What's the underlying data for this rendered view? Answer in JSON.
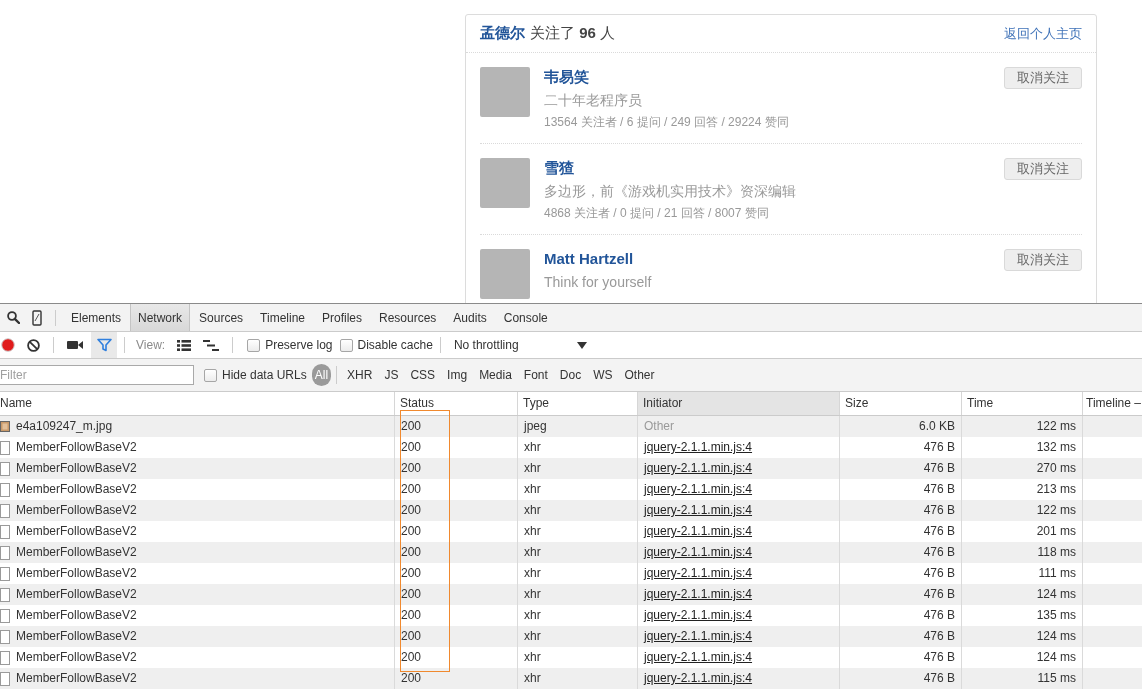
{
  "page": {
    "header": {
      "user": "孟德尔",
      "summary": "关注了 **96** 人",
      "back_link": "返回个人主页"
    },
    "followees": [
      {
        "name": "韦易笑",
        "bio": "二十年老程序员",
        "stats": "13564 关注者 / 6 提问 / 249 回答 / 29224 赞同",
        "button": "取消关注"
      },
      {
        "name": "雪猹",
        "bio": "多边形，前《游戏机实用技术》资深编辑",
        "stats": "4868 关注者 / 0 提问 / 21 回答 / 8007 赞同",
        "button": "取消关注"
      },
      {
        "name": "Matt Hartzell",
        "bio": "Think for yourself",
        "button": "取消关注"
      }
    ]
  },
  "devtools": {
    "tabs": [
      {
        "label": "Elements",
        "selected": false
      },
      {
        "label": "Network",
        "selected": true
      },
      {
        "label": "Sources",
        "selected": false
      },
      {
        "label": "Timeline",
        "selected": false
      },
      {
        "label": "Profiles",
        "selected": false
      },
      {
        "label": "Resources",
        "selected": false
      },
      {
        "label": "Audits",
        "selected": false
      },
      {
        "label": "Console",
        "selected": false
      }
    ],
    "toolbar": {
      "recording": true,
      "filter_active": true,
      "view_label": "View:",
      "checkboxes": [
        {
          "label": "Preserve log",
          "checked": false
        },
        {
          "label": "Disable cache",
          "checked": false
        }
      ],
      "throttling": "No throttling"
    },
    "filter_bar": {
      "placeholder": "Filter",
      "hide_data_urls": {
        "label": "Hide data URLs",
        "checked": false
      },
      "types": [
        {
          "label": "All",
          "selected": true
        },
        {
          "label": "XHR",
          "selected": false
        },
        {
          "label": "JS",
          "selected": false
        },
        {
          "label": "CSS",
          "selected": false
        },
        {
          "label": "Img",
          "selected": false
        },
        {
          "label": "Media",
          "selected": false
        },
        {
          "label": "Font",
          "selected": false
        },
        {
          "label": "Doc",
          "selected": false
        },
        {
          "label": "WS",
          "selected": false
        },
        {
          "label": "Other",
          "selected": false
        }
      ]
    },
    "table": {
      "columns": [
        {
          "label": "Name",
          "sorted": false
        },
        {
          "label": "Status",
          "sorted": false
        },
        {
          "label": "Type",
          "sorted": false
        },
        {
          "label": "Initiator",
          "sorted": true
        },
        {
          "label": "Size",
          "sorted": false
        },
        {
          "label": "Time",
          "sorted": false
        },
        {
          "label": "Timeline –",
          "sorted": false
        }
      ],
      "annotation": {
        "kind": "rectangle"
      },
      "rows": [
        {
          "kind": "image",
          "name": "e4a109247_m.jpg",
          "status": "200",
          "type": "jpeg",
          "initiator": "Other",
          "initiator_link": false,
          "size": "6.0 KB",
          "time": "122 ms"
        },
        {
          "kind": "xhr",
          "name": "MemberFollowBaseV2",
          "status": "200",
          "type": "xhr",
          "initiator": "jquery-2.1.1.min.js:4",
          "initiator_link": true,
          "size": "476 B",
          "time": "132 ms"
        },
        {
          "kind": "xhr",
          "name": "MemberFollowBaseV2",
          "status": "200",
          "type": "xhr",
          "initiator": "jquery-2.1.1.min.js:4",
          "initiator_link": true,
          "size": "476 B",
          "time": "270 ms"
        },
        {
          "kind": "xhr",
          "name": "MemberFollowBaseV2",
          "status": "200",
          "type": "xhr",
          "initiator": "jquery-2.1.1.min.js:4",
          "initiator_link": true,
          "size": "476 B",
          "time": "213 ms"
        },
        {
          "kind": "xhr",
          "name": "MemberFollowBaseV2",
          "status": "200",
          "type": "xhr",
          "initiator": "jquery-2.1.1.min.js:4",
          "initiator_link": true,
          "size": "476 B",
          "time": "122 ms"
        },
        {
          "kind": "xhr",
          "name": "MemberFollowBaseV2",
          "status": "200",
          "type": "xhr",
          "initiator": "jquery-2.1.1.min.js:4",
          "initiator_link": true,
          "size": "476 B",
          "time": "201 ms"
        },
        {
          "kind": "xhr",
          "name": "MemberFollowBaseV2",
          "status": "200",
          "type": "xhr",
          "initiator": "jquery-2.1.1.min.js:4",
          "initiator_link": true,
          "size": "476 B",
          "time": "118 ms"
        },
        {
          "kind": "xhr",
          "name": "MemberFollowBaseV2",
          "status": "200",
          "type": "xhr",
          "initiator": "jquery-2.1.1.min.js:4",
          "initiator_link": true,
          "size": "476 B",
          "time": "111 ms"
        },
        {
          "kind": "xhr",
          "name": "MemberFollowBaseV2",
          "status": "200",
          "type": "xhr",
          "initiator": "jquery-2.1.1.min.js:4",
          "initiator_link": true,
          "size": "476 B",
          "time": "124 ms"
        },
        {
          "kind": "xhr",
          "name": "MemberFollowBaseV2",
          "status": "200",
          "type": "xhr",
          "initiator": "jquery-2.1.1.min.js:4",
          "initiator_link": true,
          "size": "476 B",
          "time": "135 ms"
        },
        {
          "kind": "xhr",
          "name": "MemberFollowBaseV2",
          "status": "200",
          "type": "xhr",
          "initiator": "jquery-2.1.1.min.js:4",
          "initiator_link": true,
          "size": "476 B",
          "time": "124 ms"
        },
        {
          "kind": "xhr",
          "name": "MemberFollowBaseV2",
          "status": "200",
          "type": "xhr",
          "initiator": "jquery-2.1.1.min.js:4",
          "initiator_link": true,
          "size": "476 B",
          "time": "124 ms"
        },
        {
          "kind": "xhr",
          "name": "MemberFollowBaseV2",
          "status": "200",
          "type": "xhr",
          "initiator": "jquery-2.1.1.min.js:4",
          "initiator_link": true,
          "size": "476 B",
          "time": "115 ms"
        }
      ]
    }
  }
}
